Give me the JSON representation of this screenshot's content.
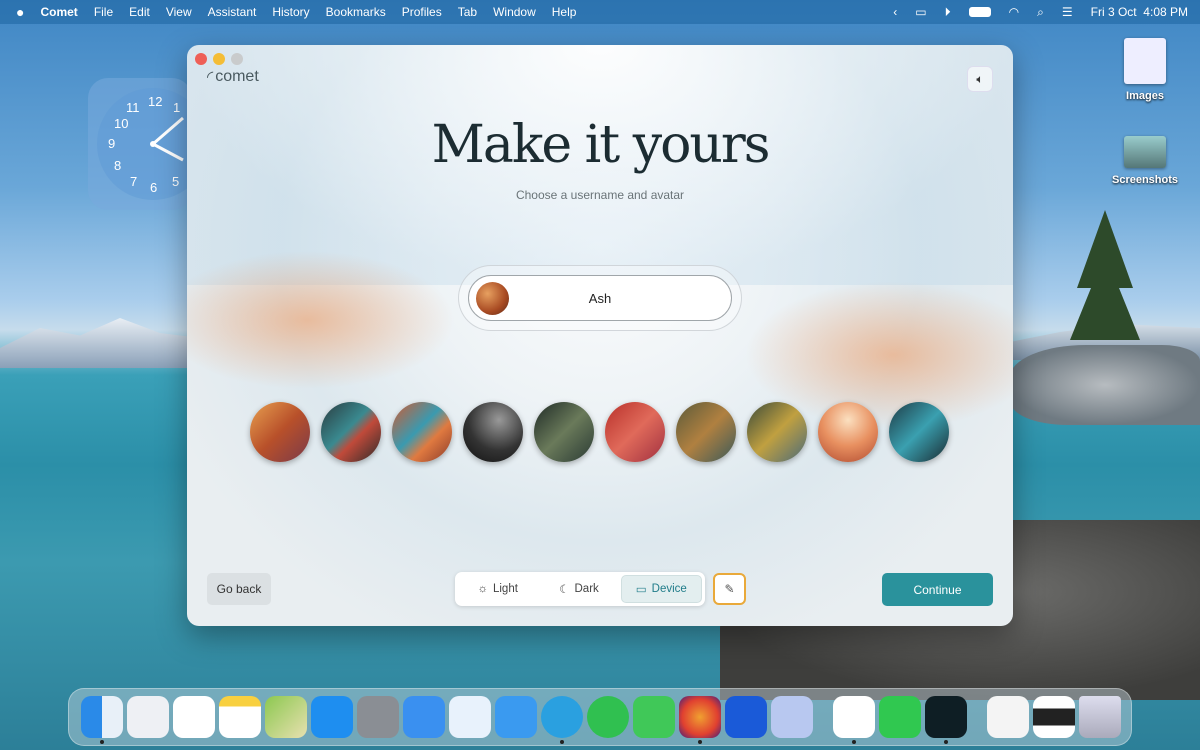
{
  "menubar": {
    "apple": "",
    "app": "Comet",
    "items": [
      "File",
      "Edit",
      "View",
      "Assistant",
      "History",
      "Bookmarks",
      "Profiles",
      "Tab",
      "Window",
      "Help"
    ],
    "datetime": "Fri 3 Oct  4:08 PM"
  },
  "clock": {
    "numbers": [
      "12",
      "1",
      "11",
      "10",
      "9",
      "8",
      "7",
      "6",
      "5"
    ]
  },
  "desktop": {
    "icons": [
      "Images",
      "Screenshots"
    ]
  },
  "window": {
    "logo": "comet",
    "title": "Make it yours",
    "subtitle": "Choose a username and avatar",
    "username": "Ash",
    "go_back": "Go back",
    "theme": {
      "options": [
        "Light",
        "Dark",
        "Device"
      ],
      "selected": "Device"
    },
    "continue": "Continue",
    "accent": "#2a929c"
  },
  "dock": {
    "apps": [
      "Finder",
      "Launchpad",
      "Reminders",
      "Notes",
      "Maps",
      "App Store",
      "System Settings",
      "Mail",
      "Safari",
      "Xcode",
      "Telegram",
      "WhatsApp",
      "Messages",
      "Firefox",
      "Bitwarden",
      "Simulator",
      "TextEdit",
      "Phone",
      "Comet",
      "Document",
      "Screenshot",
      "Trash"
    ]
  }
}
